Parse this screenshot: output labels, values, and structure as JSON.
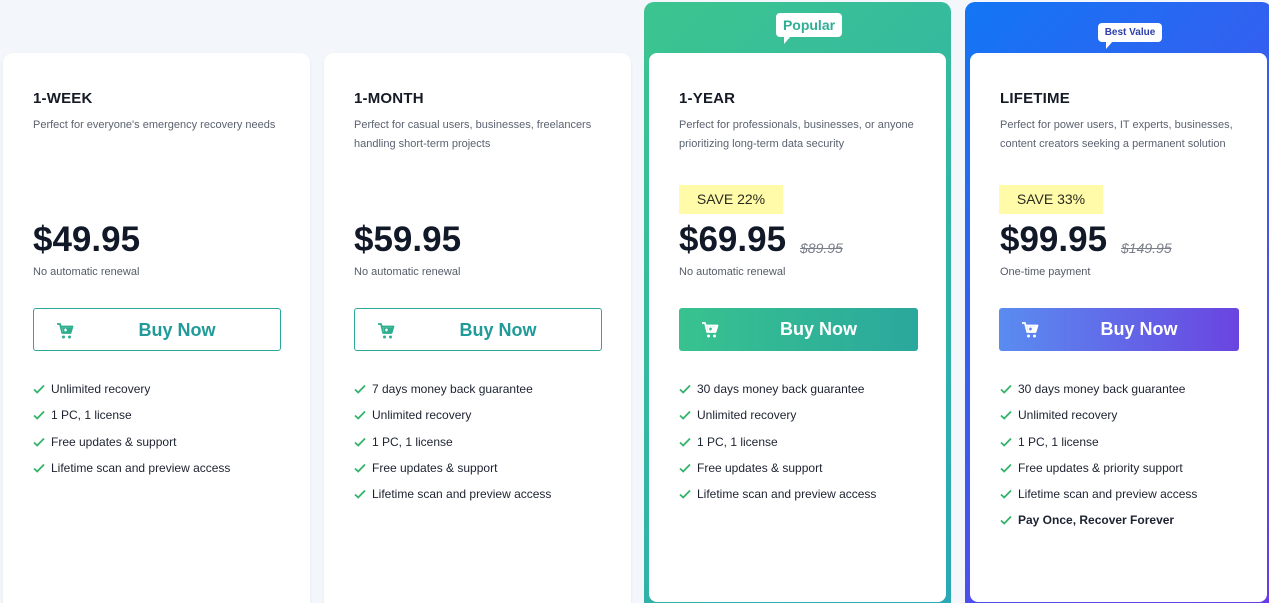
{
  "colors": {
    "accent_teal": "#2fa69a",
    "popular_gradient": [
      "#3cc58f",
      "#2aa8b6"
    ],
    "best_value_gradient": [
      "#1276f5",
      "#6a3be6"
    ],
    "save_badge_bg": "#fffba8",
    "check_green": "#34b36b"
  },
  "plans": [
    {
      "name": "1-WEEK",
      "description": "Perfect for everyone's emergency recovery needs",
      "price": "$49.95",
      "price_note": "No automatic renewal",
      "buy_label": "Buy Now",
      "features": [
        "Unlimited recovery",
        "1 PC, 1 license",
        "Free updates & support",
        "Lifetime scan and preview access"
      ]
    },
    {
      "name": "1-MONTH",
      "description": "Perfect for casual users, businesses, freelancers handling short-term projects",
      "price": "$59.95",
      "price_note": "No automatic renewal",
      "buy_label": "Buy Now",
      "features": [
        "7 days money back guarantee",
        "Unlimited recovery",
        "1 PC, 1 license",
        "Free updates & support",
        "Lifetime scan and preview access"
      ]
    },
    {
      "ribbon": "Popular",
      "name": "1-YEAR",
      "description": "Perfect for professionals, businesses, or anyone prioritizing long-term data security",
      "save_badge": "SAVE 22%",
      "price": "$69.95",
      "old_price": "$89.95",
      "price_note": "No automatic renewal",
      "buy_label": "Buy Now",
      "features": [
        "30 days money back guarantee",
        "Unlimited recovery",
        "1 PC, 1 license",
        "Free updates & support",
        "Lifetime scan and preview access"
      ]
    },
    {
      "ribbon": "Best Value",
      "name": "LIFETIME",
      "description": "Perfect for power users, IT experts, businesses, content creators seeking a permanent solution",
      "save_badge": "SAVE 33%",
      "price": "$99.95",
      "old_price": "$149.95",
      "price_note": "One-time payment",
      "buy_label": "Buy Now",
      "features": [
        "30 days money back guarantee",
        "Unlimited recovery",
        "1 PC, 1 license",
        "Free updates & priority support",
        "Lifetime scan and preview access",
        "Pay Once, Recover Forever"
      ]
    }
  ],
  "icons": {
    "cart": "shopping-cart-icon",
    "check": "checkmark-icon"
  }
}
